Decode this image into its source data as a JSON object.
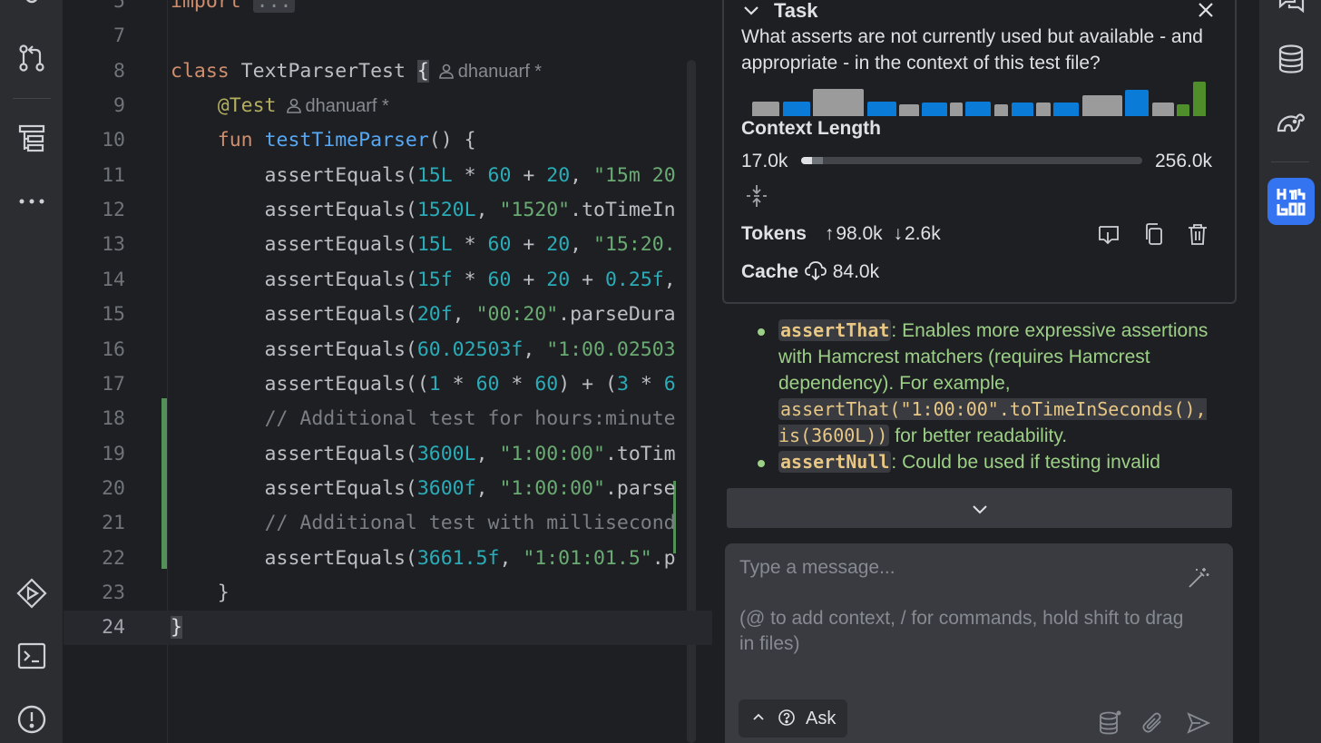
{
  "editor": {
    "lines": [
      {
        "n": "",
        "html": ""
      },
      {
        "n": "7",
        "html": ""
      },
      {
        "n": "8",
        "html": "<span class=\"kw\">class</span> TextParserTest <span class=\"brace-hl\">{</span>"
      },
      {
        "n": "9",
        "html": "    <span class=\"ann\">@Test</span>"
      },
      {
        "n": "10",
        "html": "    <span class=\"kw\">fun</span> <span class=\"fn\">testTimeParser</span>() {"
      },
      {
        "n": "11",
        "html": "        assertEquals(<span class=\"num\">15L</span> * <span class=\"num\">60</span> + <span class=\"num\">20</span>, <span class=\"str\">\"15m 20</span>"
      },
      {
        "n": "12",
        "html": "        assertEquals(<span class=\"num\">1520L</span>, <span class=\"str\">\"1520\"</span>.toTimeIn"
      },
      {
        "n": "13",
        "html": "        assertEquals(<span class=\"num\">15L</span> * <span class=\"num\">60</span> + <span class=\"num\">20</span>, <span class=\"str\">\"15:20.</span>"
      },
      {
        "n": "14",
        "html": "        assertEquals(<span class=\"num\">15f</span> * <span class=\"num\">60</span> + <span class=\"num\">20</span> + <span class=\"num\">0.25f</span>,"
      },
      {
        "n": "15",
        "html": "        assertEquals(<span class=\"num\">20f</span>, <span class=\"str\">\"00:20\"</span>.parseDura"
      },
      {
        "n": "16",
        "html": "        assertEquals(<span class=\"num\">60.02503f</span>, <span class=\"str\">\"1:00.02503</span>"
      },
      {
        "n": "17",
        "html": "        assertEquals((<span class=\"num\">1</span> * <span class=\"num\">60</span> * <span class=\"num\">60</span>) + (<span class=\"num\">3</span> * <span class=\"num\">6</span>"
      },
      {
        "n": "18",
        "html": "        <span class=\"cm\">// Additional test for hours:minute</span>"
      },
      {
        "n": "19",
        "html": "        assertEquals(<span class=\"num\">3600L</span>, <span class=\"str\">\"1:00:00\"</span>.toTim"
      },
      {
        "n": "20",
        "html": "        assertEquals(<span class=\"num\">3600f</span>, <span class=\"str\">\"1:00:00\"</span>.parse"
      },
      {
        "n": "21",
        "html": "        <span class=\"cm\">// Additional test with millisecond</span>"
      },
      {
        "n": "22",
        "html": "        assertEquals(<span class=\"num\">3661.5f</span>, <span class=\"str\">\"1:01:01.5\"</span>.p"
      },
      {
        "n": "23",
        "html": "    }"
      },
      {
        "n": "24",
        "html": "<span class=\"brace-hl\">}</span>"
      }
    ],
    "import_keyword": "import",
    "import_fold": "...",
    "author_class": "dhanuarf *",
    "author_test": "dhanuarf *"
  },
  "task": {
    "title": "Task",
    "question": "What asserts are not currently used but available - and appropriate - in the context of this test file?",
    "context_label": "Context Length",
    "context_used": "17.0k",
    "context_max": "256.0k",
    "context_fraction": 0.066,
    "tokens_label": "Tokens",
    "tokens_up": "98.0k",
    "tokens_down": "2.6k",
    "cache_label": "Cache",
    "cache_value": "84.0k",
    "bar_colors": {
      "gray": "#9b9b9b",
      "blue": "#0a7bd6",
      "green": "#4f8e2a"
    }
  },
  "response": {
    "item1_code": "assertThat",
    "item1_text": ": Enables more expressive assertions with Hamcrest matchers (requires Hamcrest dependency). For example, ",
    "item1_example": "assertThat(\"1:00:00\".toTimeInSeconds(), is(3600L))",
    "item1_tail": " for better readability.",
    "item2_code": "assertNull",
    "item2_text": ": Could be used if testing invalid"
  },
  "input": {
    "placeholder": "Type a message...",
    "hint": "(@ to add context, / for commands, hold shift to drag in files)",
    "mode": "Ask"
  }
}
